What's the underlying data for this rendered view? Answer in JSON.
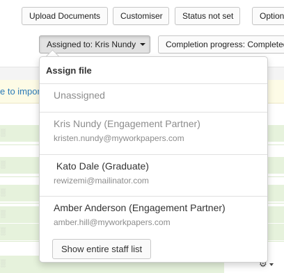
{
  "toolbar": {
    "upload_label": "Upload Documents",
    "customiser_label": "Customiser",
    "status_label": "Status not set",
    "options_label": "Option"
  },
  "filters": {
    "assigned_label": "Assigned to: Kris Nundy",
    "completion_label": "Completion progress: Completed"
  },
  "banner": {
    "text": "e to impor"
  },
  "rows": [
    {
      "mark": "░"
    },
    {
      "mark": "░"
    },
    {
      "mark": "░"
    },
    {
      "mark": "░"
    },
    {
      "mark": "░"
    },
    {
      "mark": "░"
    },
    {
      "mark": "░"
    },
    {
      "mark": "░"
    }
  ],
  "assign_menu": {
    "title": "Assign file",
    "options": [
      {
        "name": "Unassigned",
        "email": ""
      },
      {
        "name": "Kris Nundy (Engagement Partner)",
        "email": "kristen.nundy@myworkpapers.com"
      },
      {
        "name": " Kato Dale (Graduate)",
        "email": "rewizemi@mailinator.com"
      },
      {
        "name": "Amber Anderson (Engagement Partner)",
        "email": "amber.hill@myworkpapers.com"
      }
    ],
    "show_all_label": "Show entire staff list"
  },
  "icons": {
    "gear": "gear-icon",
    "caret": "caret-down-icon"
  },
  "colors": {
    "link": "#2a7ab8",
    "banner_bg": "#fdfbe6",
    "row_green": "#e6f2dc"
  }
}
